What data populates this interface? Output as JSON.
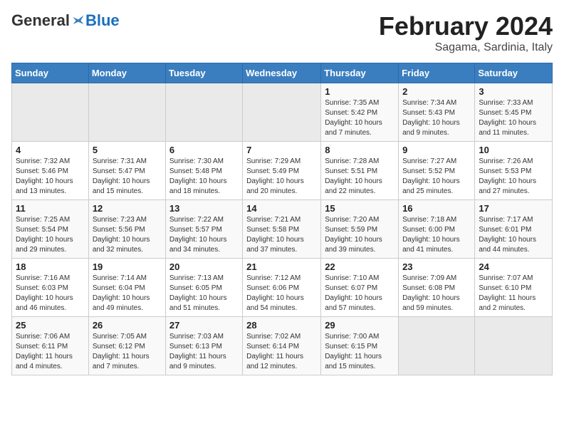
{
  "header": {
    "logo_general": "General",
    "logo_blue": "Blue",
    "title": "February 2024",
    "subtitle": "Sagama, Sardinia, Italy"
  },
  "weekdays": [
    "Sunday",
    "Monday",
    "Tuesday",
    "Wednesday",
    "Thursday",
    "Friday",
    "Saturday"
  ],
  "weeks": [
    [
      {
        "day": "",
        "info": ""
      },
      {
        "day": "",
        "info": ""
      },
      {
        "day": "",
        "info": ""
      },
      {
        "day": "",
        "info": ""
      },
      {
        "day": "1",
        "info": "Sunrise: 7:35 AM\nSunset: 5:42 PM\nDaylight: 10 hours\nand 7 minutes."
      },
      {
        "day": "2",
        "info": "Sunrise: 7:34 AM\nSunset: 5:43 PM\nDaylight: 10 hours\nand 9 minutes."
      },
      {
        "day": "3",
        "info": "Sunrise: 7:33 AM\nSunset: 5:45 PM\nDaylight: 10 hours\nand 11 minutes."
      }
    ],
    [
      {
        "day": "4",
        "info": "Sunrise: 7:32 AM\nSunset: 5:46 PM\nDaylight: 10 hours\nand 13 minutes."
      },
      {
        "day": "5",
        "info": "Sunrise: 7:31 AM\nSunset: 5:47 PM\nDaylight: 10 hours\nand 15 minutes."
      },
      {
        "day": "6",
        "info": "Sunrise: 7:30 AM\nSunset: 5:48 PM\nDaylight: 10 hours\nand 18 minutes."
      },
      {
        "day": "7",
        "info": "Sunrise: 7:29 AM\nSunset: 5:49 PM\nDaylight: 10 hours\nand 20 minutes."
      },
      {
        "day": "8",
        "info": "Sunrise: 7:28 AM\nSunset: 5:51 PM\nDaylight: 10 hours\nand 22 minutes."
      },
      {
        "day": "9",
        "info": "Sunrise: 7:27 AM\nSunset: 5:52 PM\nDaylight: 10 hours\nand 25 minutes."
      },
      {
        "day": "10",
        "info": "Sunrise: 7:26 AM\nSunset: 5:53 PM\nDaylight: 10 hours\nand 27 minutes."
      }
    ],
    [
      {
        "day": "11",
        "info": "Sunrise: 7:25 AM\nSunset: 5:54 PM\nDaylight: 10 hours\nand 29 minutes."
      },
      {
        "day": "12",
        "info": "Sunrise: 7:23 AM\nSunset: 5:56 PM\nDaylight: 10 hours\nand 32 minutes."
      },
      {
        "day": "13",
        "info": "Sunrise: 7:22 AM\nSunset: 5:57 PM\nDaylight: 10 hours\nand 34 minutes."
      },
      {
        "day": "14",
        "info": "Sunrise: 7:21 AM\nSunset: 5:58 PM\nDaylight: 10 hours\nand 37 minutes."
      },
      {
        "day": "15",
        "info": "Sunrise: 7:20 AM\nSunset: 5:59 PM\nDaylight: 10 hours\nand 39 minutes."
      },
      {
        "day": "16",
        "info": "Sunrise: 7:18 AM\nSunset: 6:00 PM\nDaylight: 10 hours\nand 41 minutes."
      },
      {
        "day": "17",
        "info": "Sunrise: 7:17 AM\nSunset: 6:01 PM\nDaylight: 10 hours\nand 44 minutes."
      }
    ],
    [
      {
        "day": "18",
        "info": "Sunrise: 7:16 AM\nSunset: 6:03 PM\nDaylight: 10 hours\nand 46 minutes."
      },
      {
        "day": "19",
        "info": "Sunrise: 7:14 AM\nSunset: 6:04 PM\nDaylight: 10 hours\nand 49 minutes."
      },
      {
        "day": "20",
        "info": "Sunrise: 7:13 AM\nSunset: 6:05 PM\nDaylight: 10 hours\nand 51 minutes."
      },
      {
        "day": "21",
        "info": "Sunrise: 7:12 AM\nSunset: 6:06 PM\nDaylight: 10 hours\nand 54 minutes."
      },
      {
        "day": "22",
        "info": "Sunrise: 7:10 AM\nSunset: 6:07 PM\nDaylight: 10 hours\nand 57 minutes."
      },
      {
        "day": "23",
        "info": "Sunrise: 7:09 AM\nSunset: 6:08 PM\nDaylight: 10 hours\nand 59 minutes."
      },
      {
        "day": "24",
        "info": "Sunrise: 7:07 AM\nSunset: 6:10 PM\nDaylight: 11 hours\nand 2 minutes."
      }
    ],
    [
      {
        "day": "25",
        "info": "Sunrise: 7:06 AM\nSunset: 6:11 PM\nDaylight: 11 hours\nand 4 minutes."
      },
      {
        "day": "26",
        "info": "Sunrise: 7:05 AM\nSunset: 6:12 PM\nDaylight: 11 hours\nand 7 minutes."
      },
      {
        "day": "27",
        "info": "Sunrise: 7:03 AM\nSunset: 6:13 PM\nDaylight: 11 hours\nand 9 minutes."
      },
      {
        "day": "28",
        "info": "Sunrise: 7:02 AM\nSunset: 6:14 PM\nDaylight: 11 hours\nand 12 minutes."
      },
      {
        "day": "29",
        "info": "Sunrise: 7:00 AM\nSunset: 6:15 PM\nDaylight: 11 hours\nand 15 minutes."
      },
      {
        "day": "",
        "info": ""
      },
      {
        "day": "",
        "info": ""
      }
    ]
  ]
}
